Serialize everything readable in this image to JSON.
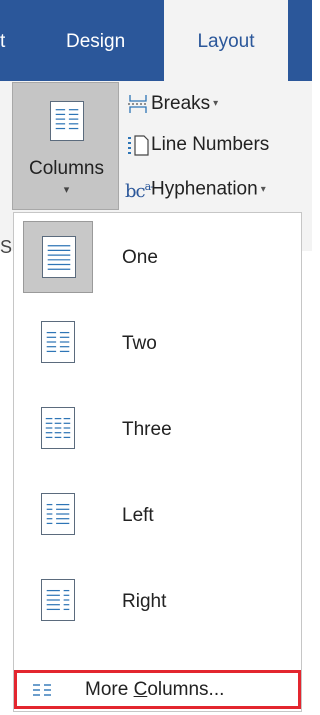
{
  "tabs": {
    "partial": "t",
    "design": "Design",
    "layout": "Layout"
  },
  "ribbon": {
    "columns_label": "Columns",
    "columns_caret": "▾",
    "breaks_label": "Breaks",
    "line_numbers_label": "Line Numbers",
    "hyphenation_label": "Hyphenation",
    "hyphenation_glyph": "bc",
    "hyphenation_glyph_sup": "a-",
    "dropdown_caret": "▾",
    "lead_text": "S"
  },
  "menu": {
    "items": [
      {
        "label": "One",
        "icon": "one-column-icon",
        "selected": true
      },
      {
        "label": "Two",
        "icon": "two-columns-icon",
        "selected": false
      },
      {
        "label": "Three",
        "icon": "three-columns-icon",
        "selected": false
      },
      {
        "label": "Left",
        "icon": "left-column-icon",
        "selected": false
      },
      {
        "label": "Right",
        "icon": "right-column-icon",
        "selected": false
      }
    ],
    "more_prefix": "More ",
    "more_underlined": "C",
    "more_suffix": "olumns...",
    "more_icon": "more-columns-icon"
  },
  "colors": {
    "ribbon_tab_blue": "#2b579a",
    "line_blue": "#2e75b6",
    "highlight_red": "#e3262f"
  }
}
